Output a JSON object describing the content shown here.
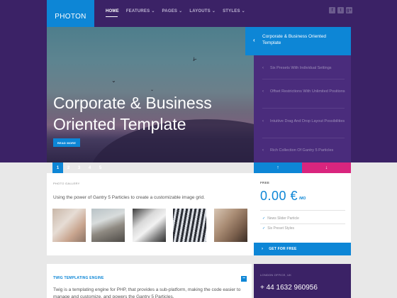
{
  "header": {
    "logo": "PHOTON",
    "nav": [
      {
        "label": "HOME",
        "active": true,
        "dropdown": false
      },
      {
        "label": "FEATURES",
        "active": false,
        "dropdown": true
      },
      {
        "label": "PAGES",
        "active": false,
        "dropdown": true
      },
      {
        "label": "LAYOUTS",
        "active": false,
        "dropdown": true
      },
      {
        "label": "STYLES",
        "active": false,
        "dropdown": true
      }
    ],
    "social": [
      "facebook-icon",
      "twitter-icon",
      "google-plus-icon"
    ]
  },
  "hero": {
    "title": "Corporate & Business Oriented Template",
    "button_label": "READ MORE",
    "pages": [
      "1",
      "2",
      "3",
      "4",
      "5"
    ],
    "active_page": "1"
  },
  "side_list": {
    "active": "Corporate & Business Oriented Template",
    "items": [
      "Six Presets With Individual Settings",
      "Offset Restrictions With Unlimited Positions",
      "Intuitive Drag And Drop Layout Possibilities",
      "Rich Collection Of Gantry 5 Particles"
    ]
  },
  "gallery": {
    "label": "PHOTO GALLERY",
    "description": "Using the power of Gantry 5 Particles to create a customizable image grid."
  },
  "pricing": {
    "label": "FREE",
    "price": "0.00 €",
    "unit": "/MO",
    "features": [
      "News Slider Particle",
      "Six Preset Styles"
    ],
    "button_label": "GET FOR FREE"
  },
  "twig": {
    "title": "TWIG TEMPLATING ENGINE",
    "text": "Twig is a templating engine for PHP, that provides a sub-platform, making the code easier to manage and customize, and powers the Gantry 5 Particles."
  },
  "office": {
    "label": "LONDON OFFICE, UK",
    "phone": "+ 44 1632 960956"
  },
  "colors": {
    "brand_blue": "#0d86d6",
    "purple_dark": "#3b2266",
    "purple_panel": "#4a2c7c",
    "pink": "#d9257e"
  }
}
